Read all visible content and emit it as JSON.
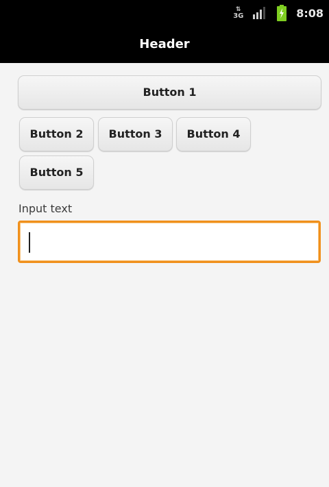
{
  "status_bar": {
    "network_label": "3G",
    "signal_icon": "signal-icon",
    "battery_icon": "battery-charging-icon",
    "time": "8:08"
  },
  "header": {
    "title": "Header"
  },
  "buttons": {
    "b1": "Button 1",
    "b2": "Button 2",
    "b3": "Button 3",
    "b4": "Button 4",
    "b5": "Button 5"
  },
  "input": {
    "label": "Input text",
    "value": "",
    "focus_color": "#f0901c"
  },
  "colors": {
    "status_bar_bg": "#000000",
    "title_bar_bg": "#000000",
    "content_bg": "#f4f4f4",
    "battery_green": "#7fce21"
  }
}
